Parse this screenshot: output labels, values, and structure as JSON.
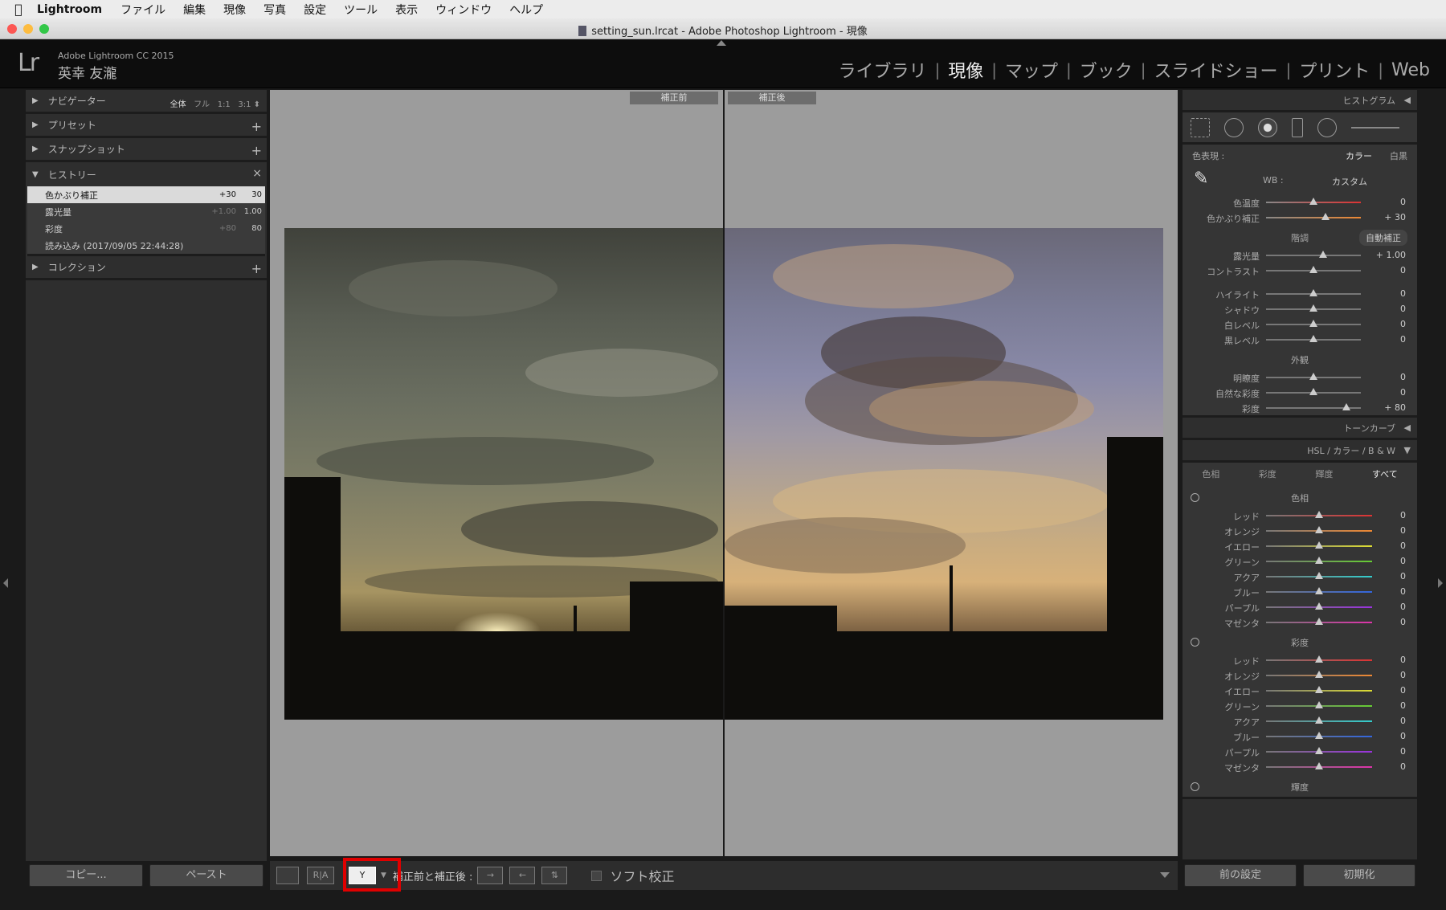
{
  "menubar": {
    "app": "Lightroom",
    "items": [
      "ファイル",
      "編集",
      "現像",
      "写真",
      "設定",
      "ツール",
      "表示",
      "ウィンドウ",
      "ヘルプ"
    ]
  },
  "window": {
    "title": "setting_sun.lrcat - Adobe Photoshop Lightroom - 現像"
  },
  "identity": {
    "logo": "Lr",
    "version": "Adobe Lightroom CC 2015",
    "user": "英幸 友瀧"
  },
  "modules": [
    "ライブラリ",
    "現像",
    "マップ",
    "ブック",
    "スライドショー",
    "プリント",
    "Web"
  ],
  "left_panel": {
    "navigator": {
      "label": "ナビゲーター",
      "sizes": [
        "全体",
        "フル",
        "1:1",
        "3:1"
      ]
    },
    "presets": {
      "label": "プリセット",
      "action": "+"
    },
    "snapshots": {
      "label": "スナップショット",
      "action": "+"
    },
    "history": {
      "label": "ヒストリー",
      "action": "×",
      "rows": [
        {
          "name": "色かぶり補正",
          "delta": "+30",
          "value": "30"
        },
        {
          "name": "露光量",
          "delta": "+1.00",
          "value": "1.00"
        },
        {
          "name": "彩度",
          "delta": "+80",
          "value": "80"
        },
        {
          "name": "読み込み (2017/09/05 22:44:28)",
          "delta": "",
          "value": ""
        }
      ]
    },
    "collections": {
      "label": "コレクション",
      "action": "+"
    },
    "copy_button": "コピー...",
    "paste_button": "ペースト"
  },
  "viewer": {
    "before_label": "補正前",
    "after_label": "補正後"
  },
  "toolbar": {
    "view_loupe": "",
    "view_ref": "R|A",
    "before_after_label": "補正前と補正後 :",
    "soft_proof": "ソフト校正"
  },
  "right_panel": {
    "histogram": "ヒストグラム",
    "treatment_label": "色表現 :",
    "treatment_color": "カラー",
    "treatment_bw": "白黒",
    "wb_label": "WB :",
    "wb_value": "カスタム",
    "wb_sliders": [
      {
        "label": "色温度",
        "pos": 0.5,
        "value": "0"
      },
      {
        "label": "色かぶり補正",
        "pos": 0.63,
        "value": "+ 30"
      }
    ],
    "tone_label": "階調",
    "auto_tone": "自動補正",
    "tone_sliders": [
      {
        "label": "露光量",
        "pos": 0.6,
        "value": "+ 1.00"
      },
      {
        "label": "コントラスト",
        "pos": 0.5,
        "value": "0"
      }
    ],
    "tone_sliders2": [
      {
        "label": "ハイライト",
        "pos": 0.5,
        "value": "0"
      },
      {
        "label": "シャドウ",
        "pos": 0.5,
        "value": "0"
      },
      {
        "label": "白レベル",
        "pos": 0.5,
        "value": "0"
      },
      {
        "label": "黒レベル",
        "pos": 0.5,
        "value": "0"
      }
    ],
    "presence_label": "外観",
    "presence_sliders": [
      {
        "label": "明瞭度",
        "pos": 0.5,
        "value": "0"
      },
      {
        "label": "自然な彩度",
        "pos": 0.5,
        "value": "0"
      },
      {
        "label": "彩度",
        "pos": 0.85,
        "value": "+ 80"
      }
    ],
    "tone_curve": "トーンカーブ",
    "hsl_header": "HSL / カラー / B & W",
    "hsl_tabs": [
      "色相",
      "彩度",
      "輝度",
      "すべて"
    ],
    "hue_label": "色相",
    "sat_label": "彩度",
    "lum_label": "輝度",
    "colors": [
      "レッド",
      "オレンジ",
      "イエロー",
      "グリーン",
      "アクア",
      "ブルー",
      "パープル",
      "マゼンタ"
    ],
    "color_values": [
      "0",
      "0",
      "0",
      "0",
      "0",
      "0",
      "0",
      "0"
    ],
    "prev_button": "前の設定",
    "reset_button": "初期化"
  }
}
